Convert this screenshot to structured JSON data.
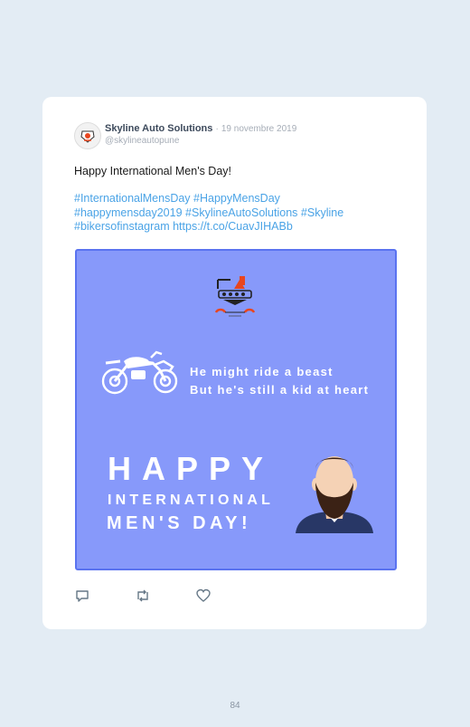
{
  "tweet": {
    "display_name": "Skyline Auto Solutions",
    "separator": "·",
    "date": "19 novembre 2019",
    "handle": "@skylineautopune",
    "text": "Happy International Men's Day!",
    "hashtags": [
      "#InternationalMensDay",
      "#HappyMensDay",
      "#happymensday2019",
      "#SkylineAutoSolutions",
      "#Skyline",
      "#bikersofinstagram"
    ],
    "link": "https://t.co/CuavJIHABb"
  },
  "media": {
    "tagline_line1": "He might ride a beast",
    "tagline_line2": "But he's still a kid at heart",
    "headline_happy": "HAPPY",
    "headline_intl": "INTERNATIONAL",
    "headline_mens_day": "MEN'S DAY!",
    "background_color": "#8799fa",
    "logo_accent_color": "#e8461f"
  },
  "actions": [
    "reply-icon",
    "retweet-icon",
    "like-icon"
  ],
  "page_number": "84",
  "colors": {
    "page_bg": "#e3ecf4",
    "card_bg": "#ffffff",
    "link_color": "#4aa3e6",
    "name_color": "#3d4a5c",
    "muted_color": "#a6adb7"
  }
}
